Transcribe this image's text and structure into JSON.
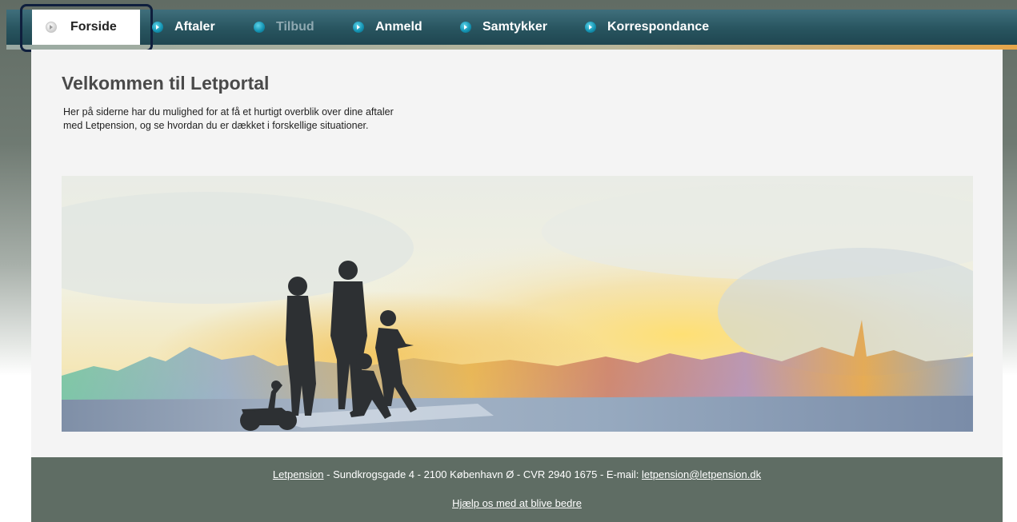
{
  "nav": {
    "items": [
      {
        "label": "Forside",
        "active": true
      },
      {
        "label": "Aftaler"
      },
      {
        "label": "Tilbud",
        "disabled": true
      },
      {
        "label": "Anmeld"
      },
      {
        "label": "Samtykker"
      },
      {
        "label": "Korrespondance"
      }
    ]
  },
  "main": {
    "title": "Velkommen til Letportal",
    "intro_line1": "Her på siderne har du mulighed for at få et hurtigt overblik over dine aftaler",
    "intro_line2": "med Letpension, og se hvordan du er dækket i forskellige situationer."
  },
  "footer": {
    "company_link": "Letpension",
    "address": " - Sundkrogsgade 4 - 2100 København Ø - CVR 2940 1675 - E-mail: ",
    "email_link": "letpension@letpension.dk",
    "feedback_link": "Hjælp os med at blive bedre"
  },
  "colors": {
    "nav_bg": "#28545f",
    "footer_bg": "#5f6d64",
    "accent_orange": "#e6a64a"
  }
}
